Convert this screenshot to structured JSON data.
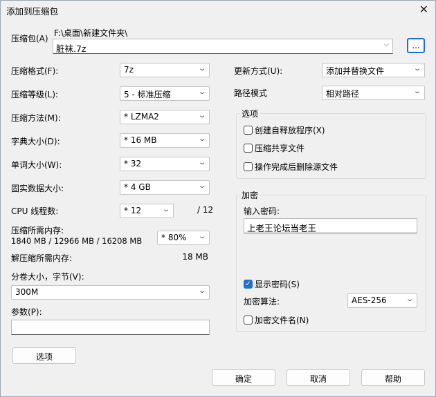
{
  "title": "添加到压缩包",
  "archive": {
    "label": "压缩包(A)",
    "path": "F:\\桌面\\新建文件夹\\",
    "filename": "脏袜.7z",
    "browse": "..."
  },
  "left": {
    "format": {
      "label": "压缩格式(F):",
      "value": "7z"
    },
    "level": {
      "label": "压缩等级(L):",
      "value": "5 - 标准压缩"
    },
    "method": {
      "label": "压缩方法(M):",
      "value": "* LZMA2"
    },
    "dict": {
      "label": "字典大小(D):",
      "value": "* 16 MB"
    },
    "word": {
      "label": "单词大小(W):",
      "value": "* 32"
    },
    "solid": {
      "label": "固实数据大小:",
      "value": "* 4 GB"
    },
    "cpu": {
      "label": "CPU 线程数:",
      "value": "* 12",
      "total": "/ 12"
    },
    "mem": {
      "label": "压缩所需内存:",
      "detail": "1840 MB / 12966 MB / 16208 MB",
      "value": "* 80%"
    },
    "decomp": {
      "label": "解压缩所需内存:",
      "value": "18 MB"
    },
    "volume": {
      "label": "分卷大小，字节(V):",
      "value": "300M"
    },
    "params": {
      "label": "参数(P):",
      "value": ""
    },
    "options_button": "选项"
  },
  "right": {
    "update": {
      "label": "更新方式(U):",
      "value": "添加并替换文件"
    },
    "pathmode": {
      "label": "路径模式",
      "value": "相对路径"
    },
    "options": {
      "legend": "选项",
      "sfx": "创建自释放程序(X)",
      "shared": "压缩共享文件",
      "delete": "操作完成后删除源文件"
    },
    "encryption": {
      "legend": "加密",
      "password_label": "输入密码:",
      "password": "上老王论坛当老王",
      "show_password": "显示密码(S)",
      "method_label": "加密算法:",
      "method": "AES-256",
      "encrypt_names": "加密文件名(N)"
    }
  },
  "buttons": {
    "ok": "确定",
    "cancel": "取消",
    "help": "帮助"
  }
}
